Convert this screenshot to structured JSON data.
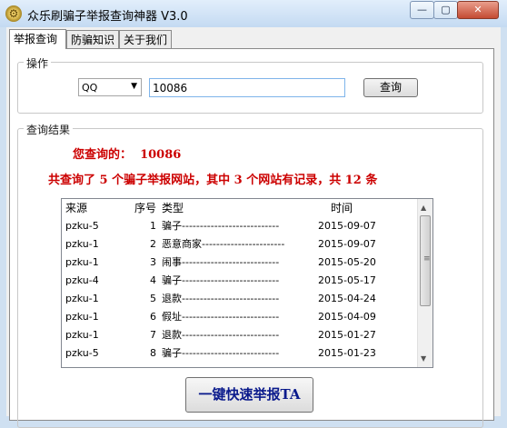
{
  "window": {
    "title": "众乐刷骗子举报查询神器 V3.0",
    "minimize_icon": "minimize-icon",
    "maximize_icon": "maximize-icon",
    "close_icon": "close-icon"
  },
  "tabs": [
    "举报查询",
    "防骗知识",
    "关于我们"
  ],
  "ops": {
    "group_title": "操作",
    "select_value": "QQ",
    "input_value": "10086",
    "query_button": "查询"
  },
  "results": {
    "group_title": "查询结果",
    "query_label": "您查询的：",
    "query_value": "10086",
    "summary": "共查询了 5 个骗子举报网站，其中 3 个网站有记录，共 12 条",
    "columns": [
      "来源",
      "序号",
      "类型",
      "时间"
    ],
    "rows": [
      {
        "source": "pzku-5",
        "no": "1",
        "type": "骗子---------------------------",
        "time": "2015-09-07"
      },
      {
        "source": "pzku-1",
        "no": "2",
        "type": "恶意商家-----------------------",
        "time": "2015-09-07"
      },
      {
        "source": "pzku-1",
        "no": "3",
        "type": "闹事---------------------------",
        "time": "2015-05-20"
      },
      {
        "source": "pzku-4",
        "no": "4",
        "type": "骗子---------------------------",
        "time": "2015-05-17"
      },
      {
        "source": "pzku-1",
        "no": "5",
        "type": "退款---------------------------",
        "time": "2015-04-24"
      },
      {
        "source": "pzku-1",
        "no": "6",
        "type": "假址---------------------------",
        "time": "2015-04-09"
      },
      {
        "source": "pzku-1",
        "no": "7",
        "type": "退款---------------------------",
        "time": "2015-01-27"
      },
      {
        "source": "pzku-5",
        "no": "8",
        "type": "骗子---------------------------",
        "time": "2015-01-23"
      }
    ],
    "report_button": "一键快速举报TA"
  },
  "colors": {
    "accent_red": "#cc0000",
    "button_text_blue": "#0a1a8c"
  }
}
